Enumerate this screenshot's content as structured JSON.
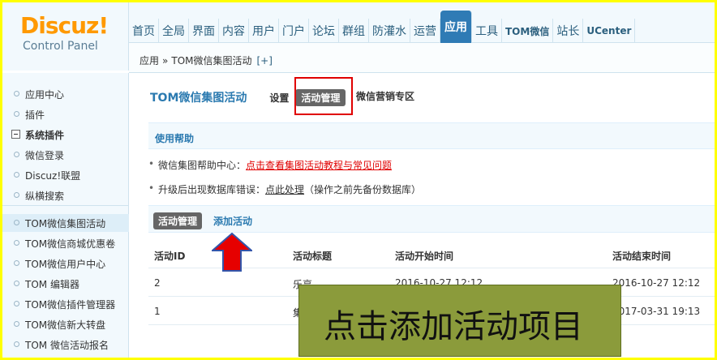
{
  "logo": {
    "name": "Discuz!",
    "subtitle": "Control Panel"
  },
  "topnav": {
    "items": [
      "首页",
      "全局",
      "界面",
      "内容",
      "用户",
      "门户",
      "论坛",
      "群组",
      "防灌水",
      "运营",
      "应用",
      "工具",
      "TOM微信",
      "站长",
      "UCenter"
    ],
    "active": "应用"
  },
  "breadcrumb": {
    "parent": "应用",
    "separator": "»",
    "current": "TOM微信集图活动",
    "add": "[+]"
  },
  "sidebar": {
    "items": [
      {
        "label": "应用中心"
      },
      {
        "label": "插件"
      },
      {
        "label": "系统插件"
      },
      {
        "label": "微信登录"
      },
      {
        "label": "Discuz!联盟"
      },
      {
        "label": "纵横搜索"
      },
      {
        "label": "TOM微信集图活动"
      },
      {
        "label": "TOM微信商城优惠卷"
      },
      {
        "label": "TOM微信用户中心"
      },
      {
        "label": "TOM 编辑器"
      },
      {
        "label": "TOM微信插件管理器"
      },
      {
        "label": "TOM微信新大转盘"
      },
      {
        "label": "TOM 微信活动报名"
      }
    ]
  },
  "page": {
    "title": "TOM微信集图活动",
    "tabs": {
      "settings": "设置",
      "manage": "活动管理",
      "marketing": "微信营销专区"
    }
  },
  "help": {
    "header": "使用帮助",
    "rows": [
      {
        "text": "微信集图帮助中心：",
        "link": "点击查看集图活动教程与常见问题"
      },
      {
        "text": "升级后出现数据库错误：",
        "link": "点此处理",
        "note": "（操作之前先备份数据库）"
      }
    ]
  },
  "actions": {
    "manage": "活动管理",
    "add": "添加活动"
  },
  "table": {
    "columns": [
      "活动ID",
      "活动标题",
      "活动开始时间",
      "活动结束时间"
    ],
    "rows": [
      [
        "2",
        "乐享",
        "2016-10-27 12:12",
        "2016-10-27 12:12"
      ],
      [
        "1",
        "集",
        "",
        "2017-03-31 19:13"
      ]
    ]
  },
  "annotation": {
    "callout": "点击添加活动项目"
  },
  "colors": {
    "accent": "#2f7bb5",
    "highlight": "#e00000",
    "callout_bg": "#8b9b3b",
    "frame": "#ffff00"
  }
}
